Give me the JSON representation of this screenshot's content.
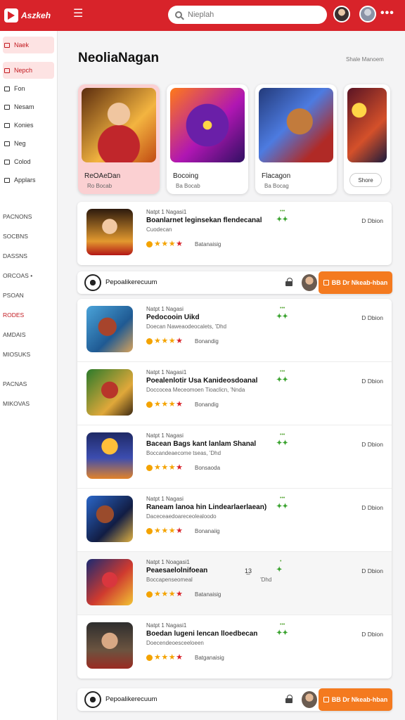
{
  "app": {
    "logo_text": "Aszkeh"
  },
  "search": {
    "placeholder": "Nieplah"
  },
  "sidebar": {
    "items": [
      {
        "label": "Naek",
        "active": true
      },
      {
        "label": "Nepch",
        "active": true
      },
      {
        "label": "Fon"
      },
      {
        "label": "Nesam"
      },
      {
        "label": "Konies"
      },
      {
        "label": "Neg"
      },
      {
        "label": "Colod"
      },
      {
        "label": "Applars"
      }
    ],
    "sections": [
      {
        "label": "PACNONS"
      },
      {
        "label": "SOCBNS"
      },
      {
        "label": "DASSNS"
      },
      {
        "label": "ORCOAS •"
      },
      {
        "label": "PSOAN"
      },
      {
        "label": "RODES",
        "red": true
      },
      {
        "label": "AMDAIS"
      },
      {
        "label": "MIOSUKS"
      },
      {
        "label": "PACNAS"
      },
      {
        "label": "MIKOVAS"
      }
    ]
  },
  "main": {
    "title": "NeoliaNagan",
    "header_link": "Shale Manoem"
  },
  "featured": [
    {
      "name": "ReOAeDan",
      "sub": "Ro Bocab"
    },
    {
      "name": "Bocoing",
      "sub": "Ba Bocab"
    },
    {
      "name": "Flacagon",
      "sub": "Ba Bocag"
    },
    {
      "more_label": "Shore"
    }
  ],
  "list1": [
    {
      "meta": "Natpt 1 Nagasi1",
      "name": "Boanlarnet leginsekan flendecanal",
      "desc": "Cuodecan",
      "rating_text": "Batanaisig",
      "badge": "•••",
      "price": "D Dbion"
    }
  ],
  "promo1": {
    "text": "Pepoalikerecuum",
    "button": "BB Dr Nkeab-hban"
  },
  "list2": [
    {
      "meta": "Natpt 1 Nagasi",
      "name": "Pedocooin Uikd",
      "desc": "Doecan Naweaodeocalets, 'Dhd",
      "rating_text": "Bonandig",
      "badge": "•••",
      "price": "D Dbion"
    },
    {
      "meta": "Natpt 1 Nagasi1",
      "name": "Poealenlotir Usa Kanideosdoanal",
      "desc": "Doccocea Meceomoen Tioaclicn, 'Nnda",
      "rating_text": "Bonandig",
      "badge": "•••",
      "price": "D Dbion"
    },
    {
      "meta": "Natpt 1 Nagasi",
      "name": "Bacean Bags kant lanlam Shanal",
      "desc": "Boccandeaecome tseas, 'Dhd",
      "rating_text": "Bonsaoda",
      "badge": "•••",
      "price": "D Dbion"
    },
    {
      "meta": "Natpt 1 Nagasi",
      "name": "Raneam lanoa hin Lindearlaerlaean)",
      "desc": "Daceceaedoareceolealoodo",
      "rating_text": "Bonanaiig",
      "badge": "•••",
      "price": "D Dbion"
    },
    {
      "meta": "Natpt 1 Noagasi1",
      "name": "Peaesaelolnifoean",
      "desc": "Boccapenseomeal",
      "count": "1̲3",
      "rating_text": "Batanaisig",
      "badge": "•",
      "price": "D Dbion",
      "tag": "'Dhd"
    },
    {
      "meta": "Natpt 1 Nagasi1",
      "name": "Boedan lugeni lencan lloedbecan",
      "desc": "Doecendeoesceeloeen",
      "rating_text": "Batganaisig",
      "badge": "•••",
      "price": "D Dbion"
    }
  ],
  "promo2": {
    "text": "Pepoalikerecuum",
    "button": "BB Dr Nkeab-hban"
  },
  "colors": {
    "brand": "#d8232a",
    "accent": "#f47a1f",
    "active_bg": "#fde3e3"
  }
}
